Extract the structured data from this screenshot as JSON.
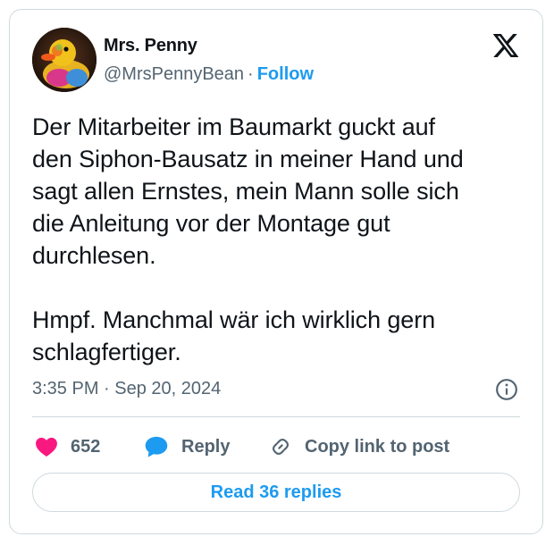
{
  "author": {
    "name": "Mrs. Penny",
    "handle": "@MrsPennyBean",
    "separator": "·",
    "follow_label": "Follow"
  },
  "brand_icon": "x-logo-icon",
  "tweet": {
    "text": "Der Mitarbeiter im Baumarkt guckt auf\nden Siphon-Bausatz in meiner Hand und\nsagt allen Ernstes, mein Mann solle sich\ndie Anleitung vor der Montage gut\ndurchlesen.\n\nHmpf. Manchmal wär ich wirklich gern\nschlagfertiger.",
    "time": "3:35 PM",
    "separator": "·",
    "date": "Sep 20, 2024"
  },
  "actions": {
    "likes": "652",
    "reply_label": "Reply",
    "copy_label": "Copy link to post"
  },
  "read_replies_label": "Read 36 replies",
  "colors": {
    "accent": "#1d9bf0",
    "heart": "#f91880",
    "reply_bubble": "#1d9bf0",
    "text": "#0f1419",
    "muted": "#536471",
    "border": "#cfd9de"
  }
}
